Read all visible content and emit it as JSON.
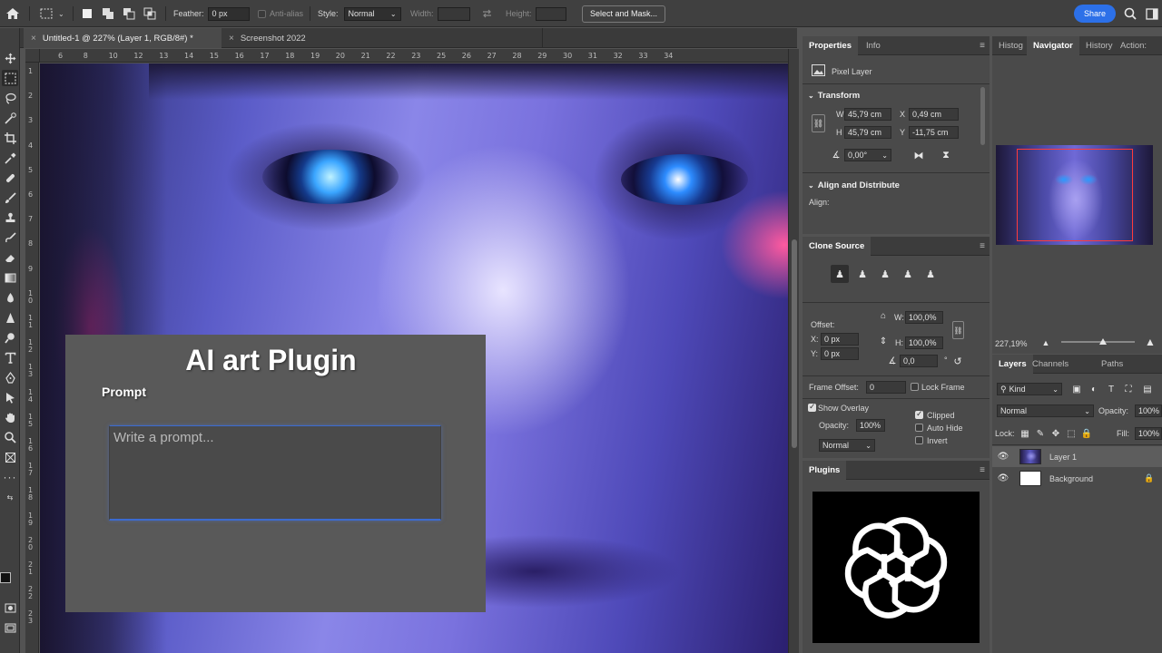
{
  "optionsBar": {
    "feather_label": "Feather:",
    "feather_value": "0 px",
    "antialias_label": "Anti-alias",
    "style_label": "Style:",
    "style_value": "Normal",
    "width_label": "Width:",
    "height_label": "Height:",
    "select_mask_label": "Select and Mask...",
    "share_label": "Share"
  },
  "tabs": [
    {
      "label": "Untitled-1 @ 227% (Layer 1, RGB/8#) *"
    },
    {
      "label": "Screenshot 2022"
    }
  ],
  "rulers": {
    "h": [
      "6",
      "8",
      "10",
      "12",
      "13",
      "14",
      "15",
      "16",
      "17",
      "18",
      "19",
      "20",
      "21",
      "22",
      "23",
      "25",
      "26",
      "27",
      "28",
      "29",
      "30",
      "31",
      "32",
      "33",
      "34"
    ],
    "v": [
      "1",
      "2",
      "3",
      "4",
      "5",
      "6",
      "7",
      "8",
      "9",
      "1\n0",
      "1\n1",
      "1\n2",
      "1\n3",
      "1\n4",
      "1\n5",
      "1\n6",
      "1\n7",
      "1\n8",
      "1\n9",
      "2\n0",
      "2\n1",
      "2\n2",
      "2\n3"
    ]
  },
  "plugin": {
    "title": "AI art Plugin",
    "prompt_label": "Prompt",
    "prompt_placeholder": "Write a prompt..."
  },
  "properties": {
    "tab_properties": "Properties",
    "tab_info": "Info",
    "layer_type": "Pixel Layer",
    "transform_title": "Transform",
    "w_label": "W",
    "w_value": "45,79 cm",
    "x_label": "X",
    "x_value": "0,49 cm",
    "h_label": "H",
    "h_value": "45,79 cm",
    "y_label": "Y",
    "y_value": "-11,75 cm",
    "angle_value": "0,00°",
    "align_title": "Align and Distribute",
    "align_label": "Align:"
  },
  "cloneSource": {
    "title": "Clone Source",
    "offset_label": "Offset:",
    "x_label": "X:",
    "x_value": "0 px",
    "y_label": "Y:",
    "y_value": "0 px",
    "w_label": "W:",
    "w_value": "100,0%",
    "h_label": "H:",
    "h_value": "100,0%",
    "angle_value": "0,0",
    "angle_unit": "°",
    "frame_offset_label": "Frame Offset:",
    "frame_offset_value": "0",
    "lock_frame_label": "Lock Frame",
    "show_overlay_label": "Show Overlay",
    "clipped_label": "Clipped",
    "opacity_label": "Opacity:",
    "opacity_value": "100%",
    "auto_hide_label": "Auto Hide",
    "invert_label": "Invert",
    "blend_value": "Normal"
  },
  "plugins": {
    "title": "Plugins"
  },
  "navigator": {
    "tab_histogram": "Histog",
    "tab_navigator": "Navigator",
    "tab_history": "History",
    "tab_actions": "Action:",
    "zoom": "227,19%"
  },
  "layers": {
    "tab_layers": "Layers",
    "tab_channels": "Channels",
    "tab_paths": "Paths",
    "kind_label": "Kind",
    "blend_value": "Normal",
    "opacity_label": "Opacity:",
    "opacity_value": "100%",
    "lock_label": "Lock:",
    "fill_label": "Fill:",
    "fill_value": "100%",
    "items": [
      {
        "name": "Layer 1"
      },
      {
        "name": "Background"
      }
    ]
  }
}
